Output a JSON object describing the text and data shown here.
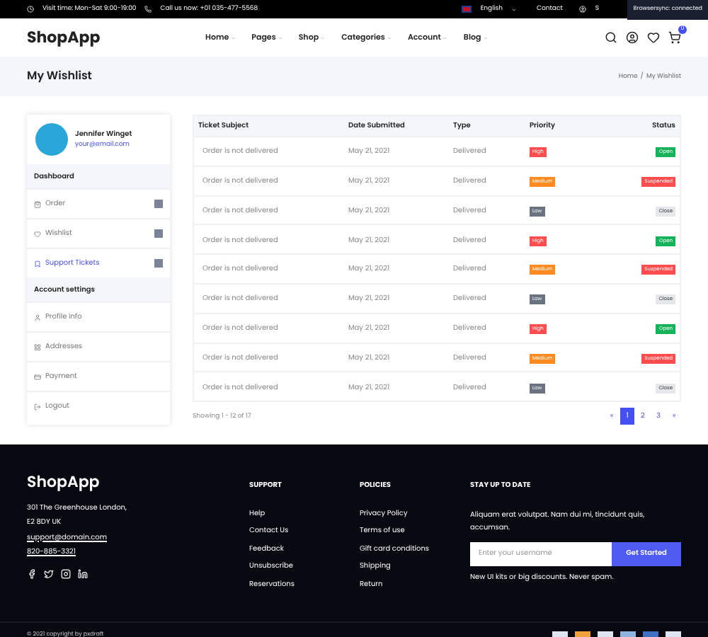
{
  "top_bar": {
    "visit_time": "Visit time: Mon-Sat 9:00-19:00",
    "phone": "Call us now: +01 035-477-5568",
    "language": "English",
    "contact": "Contact",
    "account": "S",
    "sync_notice": "Browsersync: connected"
  },
  "header": {
    "logo": "ShopApp",
    "nav": [
      "Home",
      "Pages",
      "Shop",
      "Categories",
      "Account",
      "Blog"
    ],
    "cart_count": "0"
  },
  "page_title": {
    "title": "My Wishlist",
    "breadcrumb": [
      "Home",
      "My Wishlist"
    ],
    "separator": "/"
  },
  "profile": {
    "name": "Jennifer Winget",
    "email": "your@email.com"
  },
  "sidebar": [
    {
      "heading": "Dashboard",
      "items": [
        {
          "label": "Order",
          "badge": true,
          "selected": false
        },
        {
          "label": "Wishlist",
          "badge": true,
          "selected": false
        },
        {
          "label": "Support Tickets",
          "badge": true,
          "selected": true
        }
      ]
    },
    {
      "heading": "Account settings",
      "items": [
        {
          "label": "Profile info",
          "badge": false,
          "selected": false
        },
        {
          "label": "Addresses",
          "badge": false,
          "selected": false
        },
        {
          "label": "Payment",
          "badge": false,
          "selected": false
        },
        {
          "label": "Logout",
          "badge": false,
          "selected": false
        }
      ]
    }
  ],
  "table": {
    "columns": [
      "Ticket Subject",
      "Date Submitted",
      "Type",
      "Priority",
      "Status"
    ],
    "rows": [
      {
        "subject": "Order is not delivered",
        "date": "May 21, 2021",
        "type": "Delivered",
        "priority": {
          "text": "High",
          "kind": "high"
        },
        "status": {
          "text": "Open",
          "kind": "open"
        }
      },
      {
        "subject": "Order is not delivered",
        "date": "May 21, 2021",
        "type": "Delivered",
        "priority": {
          "text": "Medium",
          "kind": "medium"
        },
        "status": {
          "text": "Suspended",
          "kind": "suspended"
        }
      },
      {
        "subject": "Order is not delivered",
        "date": "May 21, 2021",
        "type": "Delivered",
        "priority": {
          "text": "Low",
          "kind": "low"
        },
        "status": {
          "text": "Close",
          "kind": "close"
        }
      },
      {
        "subject": "Order is not delivered",
        "date": "May 21, 2021",
        "type": "Delivered",
        "priority": {
          "text": "High",
          "kind": "high"
        },
        "status": {
          "text": "Open",
          "kind": "open"
        }
      },
      {
        "subject": "Order is not delivered",
        "date": "May 21, 2021",
        "type": "Delivered",
        "priority": {
          "text": "Medium",
          "kind": "medium"
        },
        "status": {
          "text": "Suspended",
          "kind": "suspended"
        }
      },
      {
        "subject": "Order is not delivered",
        "date": "May 21, 2021",
        "type": "Delivered",
        "priority": {
          "text": "Low",
          "kind": "low"
        },
        "status": {
          "text": "Close",
          "kind": "close"
        }
      },
      {
        "subject": "Order is not delivered",
        "date": "May 21, 2021",
        "type": "Delivered",
        "priority": {
          "text": "High",
          "kind": "high"
        },
        "status": {
          "text": "Open",
          "kind": "open"
        }
      },
      {
        "subject": "Order is not delivered",
        "date": "May 21, 2021",
        "type": "Delivered",
        "priority": {
          "text": "Medium",
          "kind": "medium"
        },
        "status": {
          "text": "Suspended",
          "kind": "suspended"
        }
      },
      {
        "subject": "Order is not delivered",
        "date": "May 21, 2021",
        "type": "Delivered",
        "priority": {
          "text": "Low",
          "kind": "low"
        },
        "status": {
          "text": "Close",
          "kind": "close"
        }
      }
    ]
  },
  "pagination": {
    "summary": "Showing 1 - 12 of 17",
    "prev": "«",
    "pages": [
      {
        "label": "1",
        "selected": true
      },
      {
        "label": "2",
        "selected": false
      },
      {
        "label": "3",
        "selected": false
      }
    ],
    "next": "»"
  },
  "footer": {
    "logo": "ShopApp",
    "address": [
      "301 The Greenhouse London,",
      "E2 8DY UK"
    ],
    "email": "support@domain.com",
    "phone": "820-885-3321",
    "columns": [
      {
        "title": "SUPPORT",
        "links": [
          "Help",
          "Contact Us",
          "Feedback",
          "Unsubscribe",
          "Reservations"
        ]
      },
      {
        "title": "POLICIES",
        "links": [
          "Privacy Policy",
          "Terms of use",
          "Gift card conditions",
          "Shipping",
          "Return"
        ]
      }
    ],
    "newsletter": {
      "title": "STAY UP TO DATE",
      "text": "Aliquam erat volutpat. Nam dui mi, tincidunt quis, accumsan.",
      "placeholder": "Enter your username",
      "button": "Get Started",
      "note": "New UI kits or big discounts. Never spam."
    },
    "copyright": "© 2021 copyright by pxdraft"
  }
}
